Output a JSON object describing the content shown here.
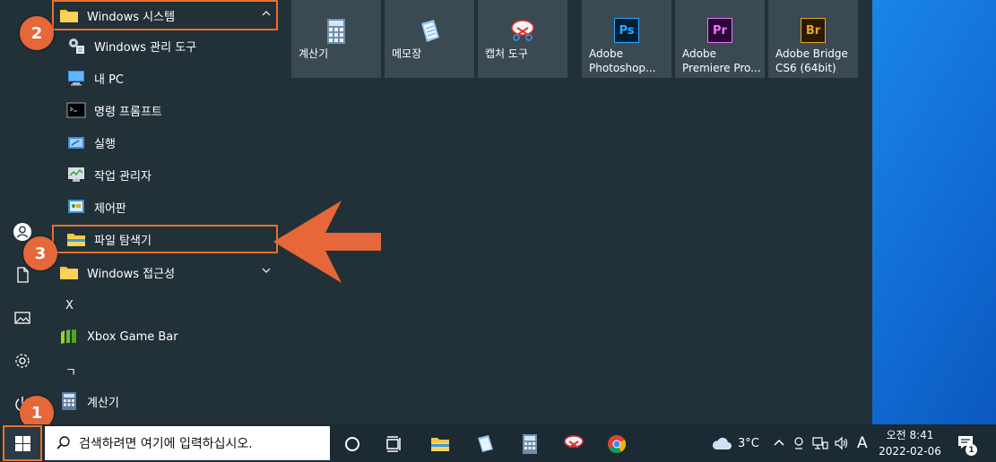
{
  "start_menu": {
    "list": {
      "windows_system_label": "Windows 시스템",
      "items": [
        {
          "label": "Windows 관리 도구",
          "icon": "admin-tools-icon"
        },
        {
          "label": "내 PC",
          "icon": "computer-icon"
        },
        {
          "label": "명령 프롬프트",
          "icon": "cmd-icon"
        },
        {
          "label": "실행",
          "icon": "run-icon"
        },
        {
          "label": "작업 관리자",
          "icon": "task-manager-icon"
        },
        {
          "label": "제어판",
          "icon": "control-panel-icon"
        },
        {
          "label": "파일 탐색기",
          "icon": "folder-icon"
        }
      ],
      "accessibility_label": "Windows 접근성",
      "letter_x": "X",
      "xbox_label": "Xbox Game Bar",
      "letter_g": "ㄱ",
      "calc_label": "계산기"
    },
    "tiles": [
      {
        "label": "계산기",
        "icon": "calculator-icon"
      },
      {
        "label": "메모장",
        "icon": "notepad-icon"
      },
      {
        "label": "캡처 도구",
        "icon": "snipping-tool-icon"
      },
      {
        "label": "Adobe Photoshop...",
        "abbr": "Ps",
        "color": "#31a8ff",
        "bg": "#001e36"
      },
      {
        "label": "Adobe Premiere Pro...",
        "abbr": "Pr",
        "color": "#ea77ff",
        "bg": "#2a0634"
      },
      {
        "label": "Adobe Bridge CS6 (64bit)",
        "abbr": "Br",
        "color": "#e8a72a",
        "bg": "#2b1a00"
      }
    ]
  },
  "badges": {
    "one": "1",
    "two": "2",
    "three": "3"
  },
  "taskbar": {
    "search_placeholder": "검색하려면 여기에 입력하십시오.",
    "weather": "3°C",
    "ime": "A",
    "time": "오전 8:41",
    "date": "2022-02-06",
    "notification_count": "1"
  },
  "colors": {
    "accent": "#e8722a",
    "menu_bg": "#223038",
    "tile_bg": "#3a4952"
  }
}
